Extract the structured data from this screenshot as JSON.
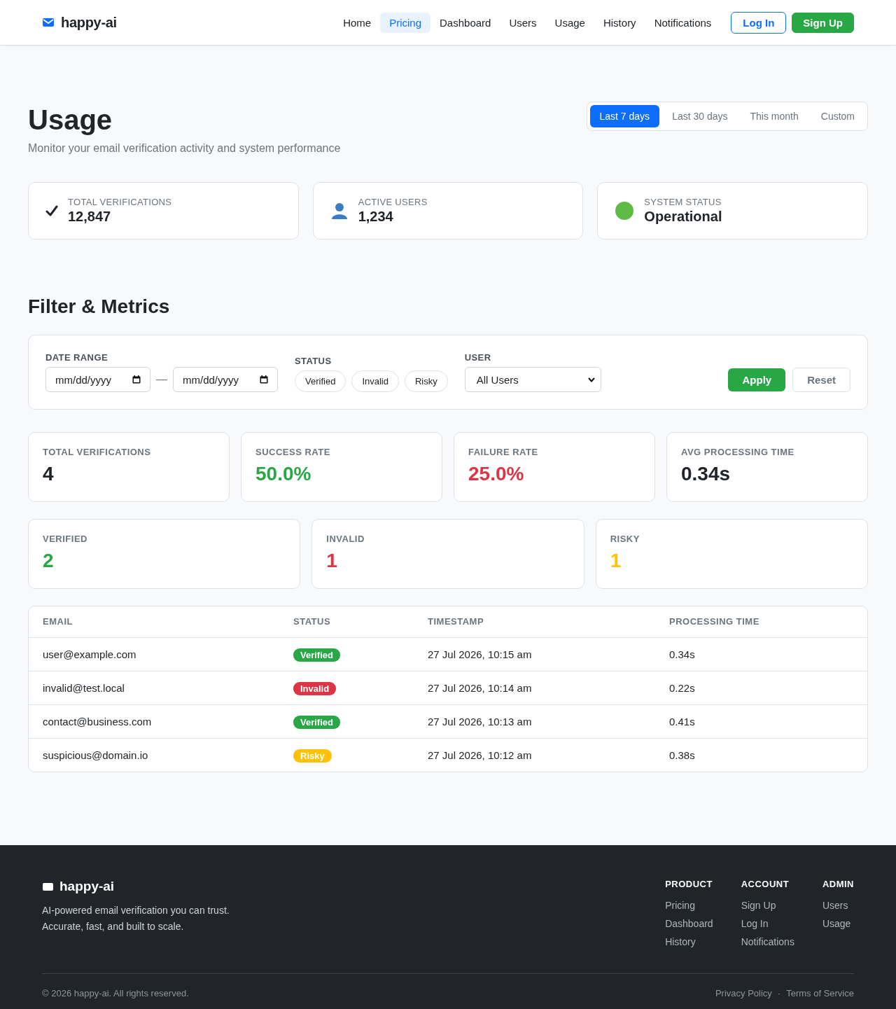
{
  "brand": {
    "name": "happy-ai"
  },
  "nav": {
    "links": [
      {
        "label": "Home",
        "selected": false
      },
      {
        "label": "Pricing",
        "selected": true
      },
      {
        "label": "Dashboard",
        "selected": false
      },
      {
        "label": "Users",
        "selected": false
      },
      {
        "label": "Usage",
        "selected": false
      },
      {
        "label": "History",
        "selected": false
      },
      {
        "label": "Notifications",
        "selected": false
      }
    ],
    "login": "Log In",
    "signup": "Sign Up"
  },
  "page": {
    "title": "Usage",
    "subtitle": "Monitor your email verification activity and system performance"
  },
  "ranges": [
    {
      "label": "Last 7 days",
      "selected": true
    },
    {
      "label": "Last 30 days",
      "selected": false
    },
    {
      "label": "This month",
      "selected": false
    },
    {
      "label": "Custom",
      "selected": false
    }
  ],
  "summary": [
    {
      "kind": "check",
      "label": "TOTAL VERIFICATIONS",
      "value": "12,847"
    },
    {
      "kind": "user",
      "label": "ACTIVE USERS",
      "value": "1,234"
    },
    {
      "kind": "status",
      "label": "SYSTEM STATUS",
      "value": "Operational"
    }
  ],
  "filter_heading": "Filter & Metrics",
  "filters": {
    "date_label": "DATE RANGE",
    "date_from": {
      "placeholder": "mm/dd/yyyy"
    },
    "separator": "—",
    "date_to": {
      "placeholder": "mm/dd/yyyy"
    },
    "status_label": "STATUS",
    "statuses": [
      {
        "label": "Verified",
        "selected": false
      },
      {
        "label": "Invalid",
        "selected": false
      },
      {
        "label": "Risky",
        "selected": false
      }
    ],
    "user_label": "USER",
    "user_value": "All Users",
    "apply": "Apply",
    "reset": "Reset"
  },
  "metrics": [
    {
      "label": "TOTAL VERIFICATIONS",
      "value": "4",
      "color": "#212529"
    },
    {
      "label": "SUCCESS RATE",
      "value": "50.0%",
      "color": "#28a745"
    },
    {
      "label": "FAILURE RATE",
      "value": "25.0%",
      "color": "#dc3545"
    },
    {
      "label": "AVG PROCESSING TIME",
      "value": "0.34s",
      "color": "#212529"
    }
  ],
  "counts": [
    {
      "label": "VERIFIED",
      "value": "2",
      "color": "#28a745"
    },
    {
      "label": "INVALID",
      "value": "1",
      "color": "#dc3545"
    },
    {
      "label": "RISKY",
      "value": "1",
      "color": "#ffc107"
    }
  ],
  "table": {
    "columns": [
      "EMAIL",
      "STATUS",
      "TIMESTAMP",
      "PROCESSING TIME"
    ],
    "rows": [
      {
        "email": "user@example.com",
        "status": "Verified",
        "color": "#28a745",
        "timestamp": "27 Jul 2026, 10:15 am",
        "time": "0.34s"
      },
      {
        "email": "invalid@test.local",
        "status": "Invalid",
        "color": "#dc3545",
        "timestamp": "27 Jul 2026, 10:14 am",
        "time": "0.22s"
      },
      {
        "email": "contact@business.com",
        "status": "Verified",
        "color": "#28a745",
        "timestamp": "27 Jul 2026, 10:13 am",
        "time": "0.41s"
      },
      {
        "email": "suspicious@domain.io",
        "status": "Risky",
        "color": "#ffc107",
        "timestamp": "27 Jul 2026, 10:12 am",
        "time": "0.38s"
      }
    ]
  },
  "footer": {
    "brand": "happy-ai",
    "tagline": [
      "AI-powered email verification you can trust.",
      "Accurate, fast, and built to scale."
    ],
    "columns": [
      {
        "heading": "PRODUCT",
        "links": [
          "Pricing",
          "Dashboard",
          "History"
        ]
      },
      {
        "heading": "ACCOUNT",
        "links": [
          "Sign Up",
          "Log In",
          "Notifications"
        ]
      },
      {
        "heading": "ADMIN",
        "links": [
          "Users",
          "Usage"
        ]
      }
    ],
    "copyright": "© 2026 happy-ai. All rights reserved.",
    "legal": [
      "Privacy Policy",
      "Terms of Service"
    ],
    "legal_separator": "·"
  }
}
